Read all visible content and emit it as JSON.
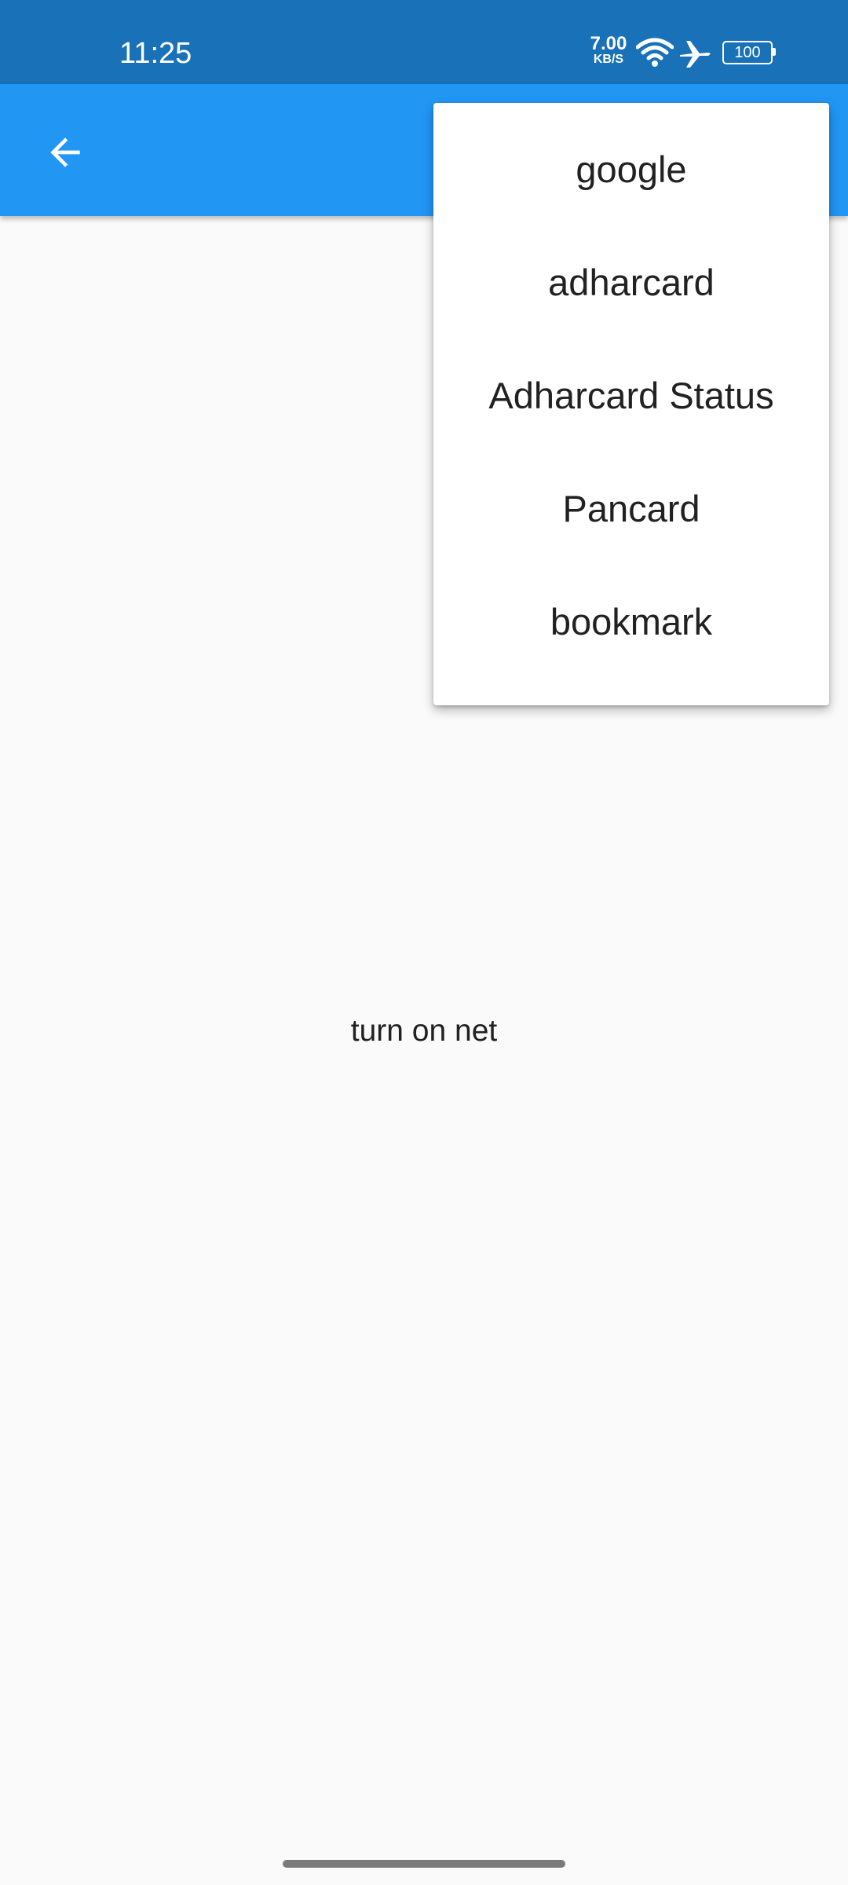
{
  "status_bar": {
    "time": "11:25",
    "net_speed_value": "7.00",
    "net_speed_unit": "KB/S",
    "battery_level": "100",
    "icons": [
      "wifi-icon",
      "airplane-mode-icon",
      "battery-icon"
    ]
  },
  "app_bar": {
    "color": "#2196f3",
    "back_icon": "arrow-left-icon"
  },
  "menu": {
    "items": [
      {
        "label": "google"
      },
      {
        "label": "adharcard"
      },
      {
        "label": "Adharcard Status"
      },
      {
        "label": "Pancard"
      },
      {
        "label": "bookmark"
      }
    ]
  },
  "content": {
    "message": "turn on net"
  },
  "colors": {
    "status_bar": "#1971b8",
    "app_bar": "#2196f3",
    "background": "#fafafa",
    "text": "#212121"
  }
}
